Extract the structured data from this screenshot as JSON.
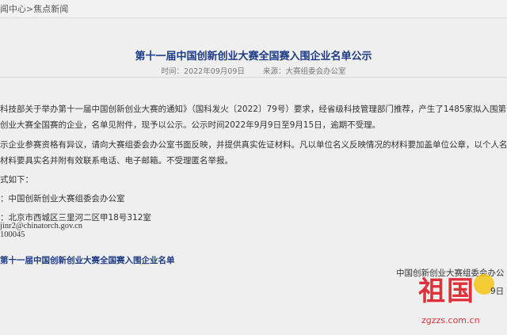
{
  "breadcrumb": "闻中心>焦点新闻",
  "article": {
    "title": "第十一届中国创新创业大赛全国赛入围企业名单公示",
    "time_label": "时间：2022年09月09日",
    "source_label": "来源：大赛组委会办公室",
    "paragraphs": [
      "科技部关于举办第十一届中国创新创业大赛的通知》（国科发火〔2022〕79号）要求，经省级科技管理部门推荐，产生了1485家拟入围第十一",
      "创业大赛全国赛的企业，名单见附件，现予以公示。公示时间2022年9月9日至9月15日，逾期不受理。",
      "示企业参赛资格有异议，请向大赛组委会办公室书面反映，并提供真实佐证材料。凡以单位名义反映情况的材料要加盖单位公章，以个人名义",
      "材料要具实名并附有效联系电话、电子邮箱。不受理匿名举报。",
      "式如下：",
      "：中国创新创业大赛组委会办公室",
      "：北京市西城区三里河二区甲18号312室",
      "100045",
      "jinr2@chinatorch.gov.cn"
    ],
    "attachment_link": "第十一届中国创新创业大赛全国赛入围企业名单",
    "signature": "中国创新创业大赛组委会办公",
    "sign_date": "9日"
  },
  "watermark": {
    "text": "祖国",
    "url": "zgzzs.com.cn"
  },
  "colors": {
    "title": "#1d3b87",
    "watermark": "#e0303a"
  }
}
